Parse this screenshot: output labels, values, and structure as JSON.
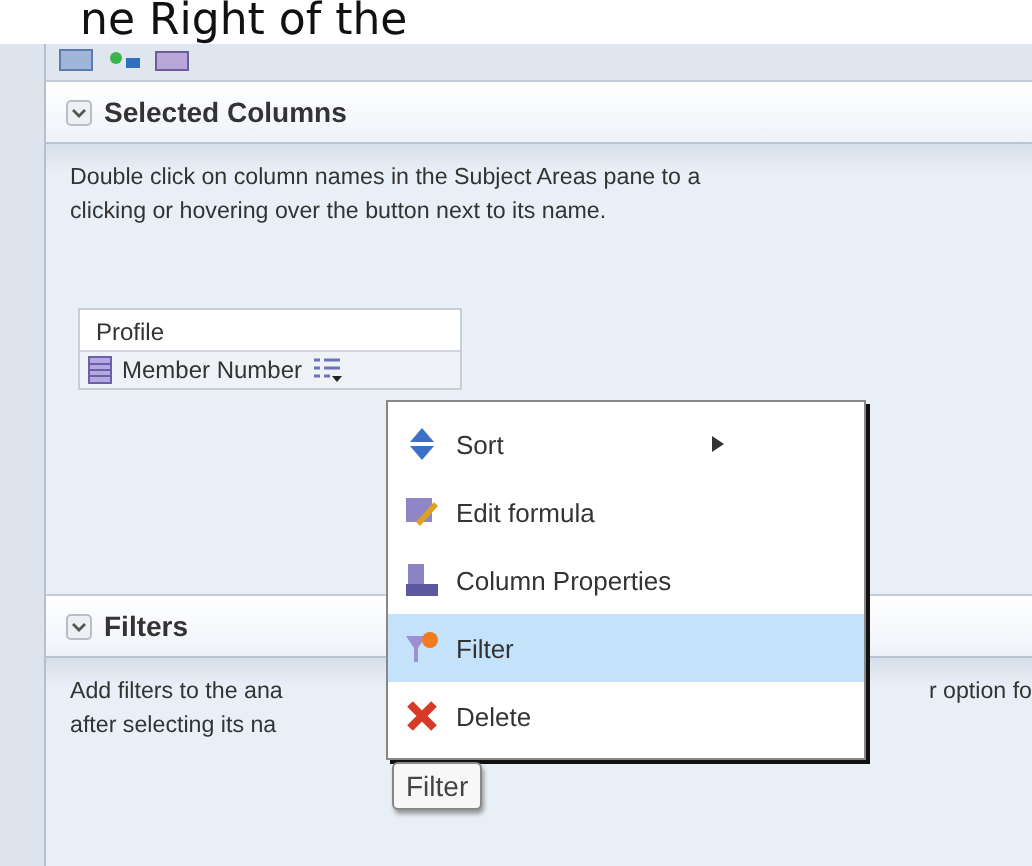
{
  "heading": "ne Right of the",
  "toolbar": [
    {
      "kind": "view"
    },
    {
      "kind": "nav"
    },
    {
      "kind": "grid"
    }
  ],
  "sections": [
    {
      "title": "Selected Columns",
      "expanded": true,
      "lines": [
        {
          "left": "Double click on column names in the Subject Areas pane to a"
        },
        {
          "left": "clicking or hovering over the button next to its name."
        }
      ]
    },
    {
      "title": "Filters",
      "expanded": true,
      "lines": [
        {
          "left": "Add filters to the ana",
          "right": "r option fo"
        },
        {
          "left": "after selecting its na"
        }
      ]
    }
  ],
  "column_group": {
    "folder": "Profile",
    "columns": [
      {
        "name": "Member Number"
      }
    ]
  },
  "menu": [
    {
      "label": "Sort",
      "kind": "sort",
      "submenu": true,
      "selected": false
    },
    {
      "label": "Edit formula",
      "kind": "formula",
      "submenu": false,
      "selected": false
    },
    {
      "label": "Column Properties",
      "kind": "properties",
      "submenu": false,
      "selected": false
    },
    {
      "label": "Filter",
      "kind": "filter",
      "submenu": false,
      "selected": true
    },
    {
      "label": "Delete",
      "kind": "delete",
      "submenu": false,
      "selected": false
    }
  ],
  "tooltip": "Filter"
}
